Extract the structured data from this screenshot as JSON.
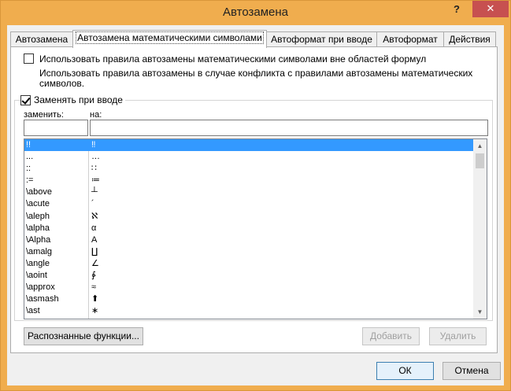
{
  "window": {
    "title": "Автозамена",
    "help_label": "?",
    "close_label": "✕"
  },
  "tabs": [
    {
      "label": "Автозамена"
    },
    {
      "label": "Автозамена математическими символами"
    },
    {
      "label": "Автоформат при вводе"
    },
    {
      "label": "Автоформат"
    },
    {
      "label": "Действия"
    }
  ],
  "options": {
    "use_outside_label": "Использовать правила автозамены математическими символами вне областей формул",
    "use_outside_checked": false,
    "conflict_desc": "Использовать правила автозамены в случае конфликта с правилами автозамены математических символов.",
    "replace_as_type_label": "Заменять при вводе",
    "replace_as_type_checked": true
  },
  "columns": {
    "replace_label": "заменить:",
    "with_label": "на:",
    "replace_value": "",
    "with_value": ""
  },
  "list": {
    "rows": [
      {
        "replace": "!!",
        "with": "‼",
        "selected": true
      },
      {
        "replace": "...",
        "with": "…"
      },
      {
        "replace": "::",
        "with": "∷"
      },
      {
        "replace": ":=",
        "with": "≔"
      },
      {
        "replace": "\\above",
        "with": "┴"
      },
      {
        "replace": "\\acute",
        "with": "´"
      },
      {
        "replace": "\\aleph",
        "with": "ℵ"
      },
      {
        "replace": "\\alpha",
        "with": "α"
      },
      {
        "replace": "\\Alpha",
        "with": "Α"
      },
      {
        "replace": "\\amalg",
        "with": "∐"
      },
      {
        "replace": "\\angle",
        "with": "∠"
      },
      {
        "replace": "\\aoint",
        "with": "∳"
      },
      {
        "replace": "\\approx",
        "with": "≈"
      },
      {
        "replace": "\\asmash",
        "with": "⬆"
      },
      {
        "replace": "\\ast",
        "with": "∗"
      }
    ]
  },
  "buttons": {
    "recognized_functions": "Распознанные функции...",
    "add": "Добавить",
    "delete": "Удалить",
    "ok": "ОК",
    "cancel": "Отмена"
  }
}
